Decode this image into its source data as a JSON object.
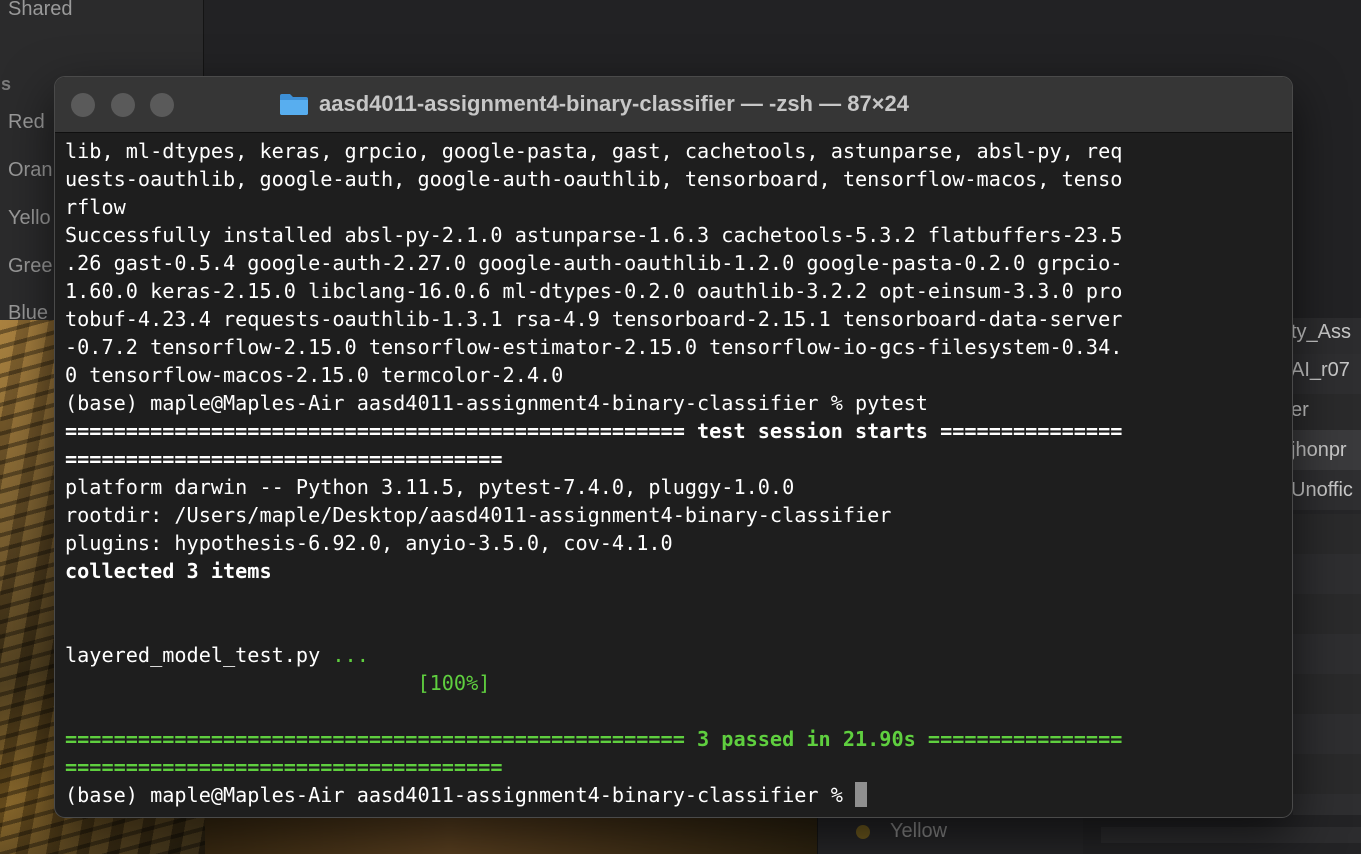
{
  "finder_sidebar": {
    "shared_label": "Shared",
    "tags_header": "gs",
    "tags": [
      "Red",
      "Oran",
      "Yello",
      "Gree",
      "Blue"
    ]
  },
  "back_window": {
    "items": [
      "ty_Ass",
      "AI_r07",
      "er",
      "jhonpr",
      "Unoffic"
    ],
    "bottom_tag": "Yellow"
  },
  "terminal": {
    "window_title": "aasd4011-assignment4-binary-classifier — -zsh — 87×24",
    "folder_icon_color": "#4aa3e8",
    "lines": [
      {
        "text": "lib, ml-dtypes, keras, grpcio, google-pasta, gast, cachetools, astunparse, absl-py, req"
      },
      {
        "text": "uests-oauthlib, google-auth, google-auth-oauthlib, tensorboard, tensorflow-macos, tenso"
      },
      {
        "text": "rflow"
      },
      {
        "text": "Successfully installed absl-py-2.1.0 astunparse-1.6.3 cachetools-5.3.2 flatbuffers-23.5"
      },
      {
        "text": ".26 gast-0.5.4 google-auth-2.27.0 google-auth-oauthlib-1.2.0 google-pasta-0.2.0 grpcio-"
      },
      {
        "text": "1.60.0 keras-2.15.0 libclang-16.0.6 ml-dtypes-0.2.0 oauthlib-3.2.2 opt-einsum-3.3.0 pro"
      },
      {
        "text": "tobuf-4.23.4 requests-oauthlib-1.3.1 rsa-4.9 tensorboard-2.15.1 tensorboard-data-server"
      },
      {
        "text": "-0.7.2 tensorflow-2.15.0 tensorflow-estimator-2.15.0 tensorflow-io-gcs-filesystem-0.34."
      },
      {
        "text": "0 tensorflow-macos-2.15.0 termcolor-2.4.0"
      },
      {
        "text": "(base) maple@Maples-Air aasd4011-assignment4-binary-classifier % pytest"
      },
      {
        "text": "=================================================== test session starts ===============",
        "style": "bold"
      },
      {
        "text": "====================================",
        "style": "bold"
      },
      {
        "text": "platform darwin -- Python 3.11.5, pytest-7.4.0, pluggy-1.0.0"
      },
      {
        "text": "rootdir: /Users/maple/Desktop/aasd4011-assignment4-binary-classifier"
      },
      {
        "text": "plugins: hypothesis-6.92.0, anyio-3.5.0, cov-4.1.0"
      },
      {
        "text": "collected 3 items",
        "style": "bold"
      },
      {
        "text": ""
      },
      {
        "text": ""
      },
      {
        "text": "layered_model_test.py",
        "suffix": " ..."
      },
      {
        "text": "",
        "suffix": "                             [100%]"
      },
      {
        "text": ""
      },
      {
        "text": "=================================================== 3 passed in 21.90s ================",
        "style": "green-bold"
      },
      {
        "text": "====================================",
        "style": "green-bold"
      },
      {
        "text": "(base) maple@Maples-Air aasd4011-assignment4-binary-classifier % ",
        "cursor": true
      }
    ]
  }
}
